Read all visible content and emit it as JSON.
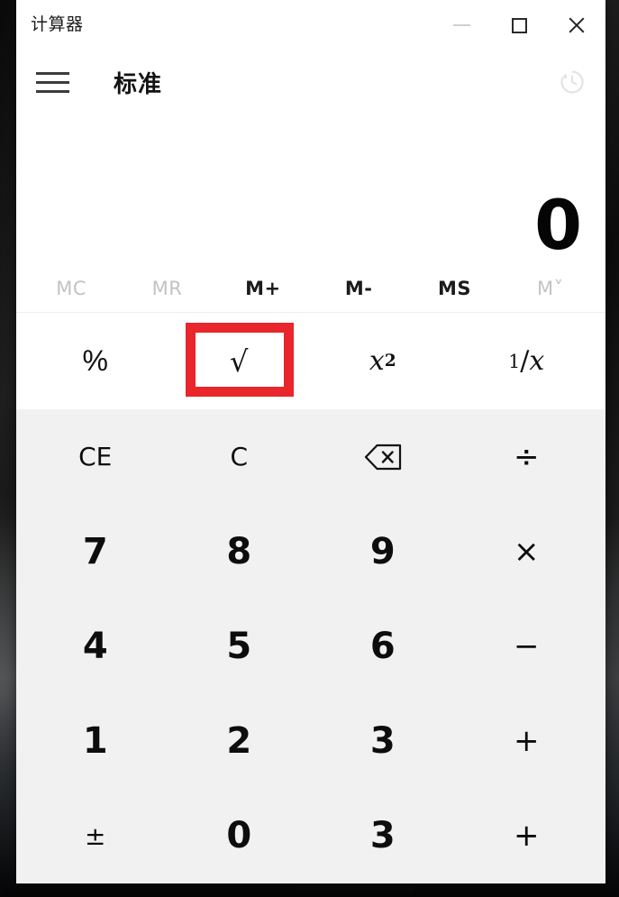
{
  "window": {
    "title": "计算器",
    "controls": {
      "minimize": "minimize-icon",
      "maximize": "maximize-icon",
      "close": "close-icon"
    }
  },
  "navbar": {
    "menu_icon": "hamburger-menu-icon",
    "mode_label": "标准",
    "history_icon": "history-clock-icon"
  },
  "display": {
    "value": "0"
  },
  "memory": {
    "buttons": [
      {
        "label": "MC",
        "enabled": false
      },
      {
        "label": "MR",
        "enabled": false
      },
      {
        "label": "M+",
        "enabled": true
      },
      {
        "label": "M-",
        "enabled": true
      },
      {
        "label": "MS",
        "enabled": true
      },
      {
        "label": "M˅",
        "enabled": false
      }
    ]
  },
  "functions": {
    "percent": "%",
    "sqrt": "√",
    "square_base": "x",
    "square_exp": "2",
    "reciprocal_num": "1",
    "reciprocal_den": "x",
    "reciprocal_slash": "/"
  },
  "keypad": {
    "rows": [
      [
        {
          "label": "CE",
          "style": "small",
          "name": "clear-entry"
        },
        {
          "label": "C",
          "style": "small",
          "name": "clear"
        },
        {
          "label": "backspace-icon",
          "style": "icon",
          "name": "backspace"
        },
        {
          "label": "÷",
          "style": "op",
          "name": "divide"
        }
      ],
      [
        {
          "label": "7",
          "style": "digit",
          "name": "digit-7"
        },
        {
          "label": "8",
          "style": "digit",
          "name": "digit-8"
        },
        {
          "label": "9",
          "style": "digit",
          "name": "digit-9"
        },
        {
          "label": "×",
          "style": "op",
          "name": "multiply"
        }
      ],
      [
        {
          "label": "4",
          "style": "digit",
          "name": "digit-4"
        },
        {
          "label": "5",
          "style": "digit",
          "name": "digit-5"
        },
        {
          "label": "6",
          "style": "digit",
          "name": "digit-6"
        },
        {
          "label": "−",
          "style": "op",
          "name": "subtract"
        }
      ],
      [
        {
          "label": "1",
          "style": "digit",
          "name": "digit-1"
        },
        {
          "label": "2",
          "style": "digit",
          "name": "digit-2"
        },
        {
          "label": "3",
          "style": "digit",
          "name": "digit-3"
        },
        {
          "label": "+",
          "style": "op",
          "name": "add"
        }
      ],
      [
        {
          "label": "±",
          "style": "small",
          "name": "negate"
        },
        {
          "label": "0",
          "style": "digit",
          "name": "digit-0"
        },
        {
          "label": "3",
          "style": "digit",
          "name": "digit-3-bottom"
        },
        {
          "label": "+",
          "style": "op",
          "name": "add-bottom"
        }
      ]
    ]
  },
  "annotation": {
    "highlight_target": "√",
    "highlight_color": "#e8262c"
  }
}
